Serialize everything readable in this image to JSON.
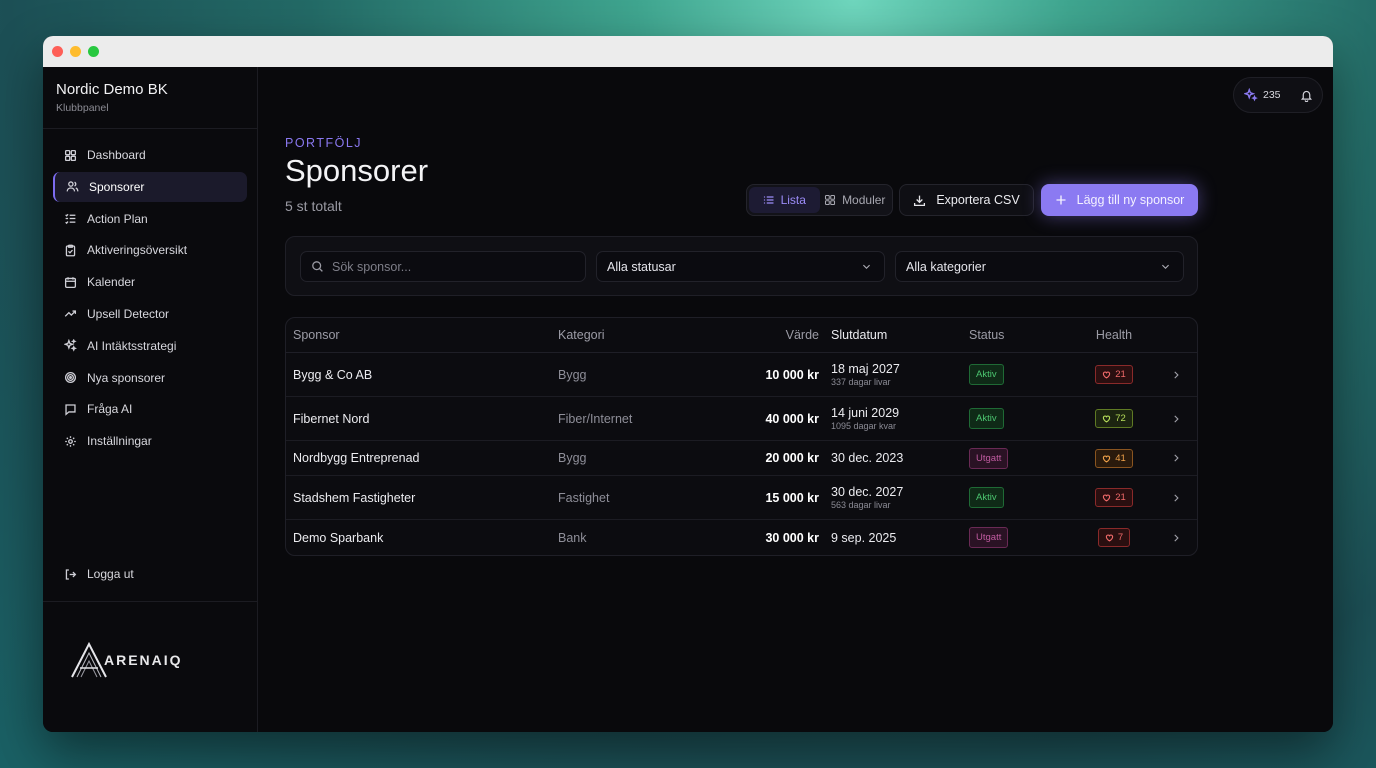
{
  "club": {
    "name": "Nordic Demo BK",
    "subtitle": "Klubbpanel"
  },
  "sidebar": {
    "items": [
      {
        "label": "Dashboard",
        "icon": "grid-icon"
      },
      {
        "label": "Sponsorer",
        "icon": "users-icon",
        "active": true
      },
      {
        "label": "Action Plan",
        "icon": "list-check-icon"
      },
      {
        "label": "Aktiveringsöversikt",
        "icon": "clipboard-icon"
      },
      {
        "label": "Kalender",
        "icon": "calendar-icon"
      },
      {
        "label": "Upsell Detector",
        "icon": "trend-up-icon"
      },
      {
        "label": "AI Intäktsstrategi",
        "icon": "sparkles-icon"
      },
      {
        "label": "Nya sponsorer",
        "icon": "target-icon"
      },
      {
        "label": "Fråga AI",
        "icon": "message-icon"
      },
      {
        "label": "Inställningar",
        "icon": "gear-icon"
      }
    ],
    "logout_label": "Logga ut",
    "logo_text": "ARENAIQ"
  },
  "topbar": {
    "count": "235"
  },
  "header": {
    "eyebrow": "PORTFÖLJ",
    "title": "Sponsorer",
    "subtitle": "5 st totalt"
  },
  "toolbar": {
    "list_label": "Lista",
    "modules_label": "Moduler",
    "export_label": "Exportera CSV",
    "add_label": "Lägg till ny sponsor"
  },
  "filters": {
    "search_placeholder": "Sök sponsor...",
    "status_value": "Alla statusar",
    "category_value": "Alla kategorier"
  },
  "table": {
    "columns": [
      "Sponsor",
      "Kategori",
      "Värde",
      "Slutdatum",
      "Status",
      "Health"
    ],
    "rows": [
      {
        "sponsor": "Bygg & Co AB",
        "kategori": "Bygg",
        "varde": "10 000 kr",
        "slutdatum": "18 maj 2027",
        "dagar": "337 dagar livar",
        "status": "Aktiv",
        "health": "21"
      },
      {
        "sponsor": "Fibernet Nord",
        "kategori": "Fiber/Internet",
        "varde": "40 000 kr",
        "slutdatum": "14 juni 2029",
        "dagar": "1095 dagar kvar",
        "status": "Aktiv",
        "health": "72"
      },
      {
        "sponsor": "Nordbygg Entreprenad",
        "kategori": "Bygg",
        "varde": "20 000 kr",
        "slutdatum": "30 dec. 2023",
        "dagar": "",
        "status": "Utgatt",
        "health": "41"
      },
      {
        "sponsor": "Stadshem Fastigheter",
        "kategori": "Fastighet",
        "varde": "15 000 kr",
        "slutdatum": "30 dec. 2027",
        "dagar": "563 dagar livar",
        "status": "Aktiv",
        "health": "21"
      },
      {
        "sponsor": "Demo Sparbank",
        "kategori": "Bank",
        "varde": "30 000 kr",
        "slutdatum": "9 sep. 2025",
        "dagar": "",
        "status": "Utgatt",
        "health": "7"
      }
    ]
  },
  "colors": {
    "accent": "#8b7af2",
    "status_active": "#4cc570",
    "status_expired": "#c05ba0",
    "health_red": "#f06a6a",
    "health_lime": "#b6dc5a",
    "health_orange": "#f0a24a"
  }
}
